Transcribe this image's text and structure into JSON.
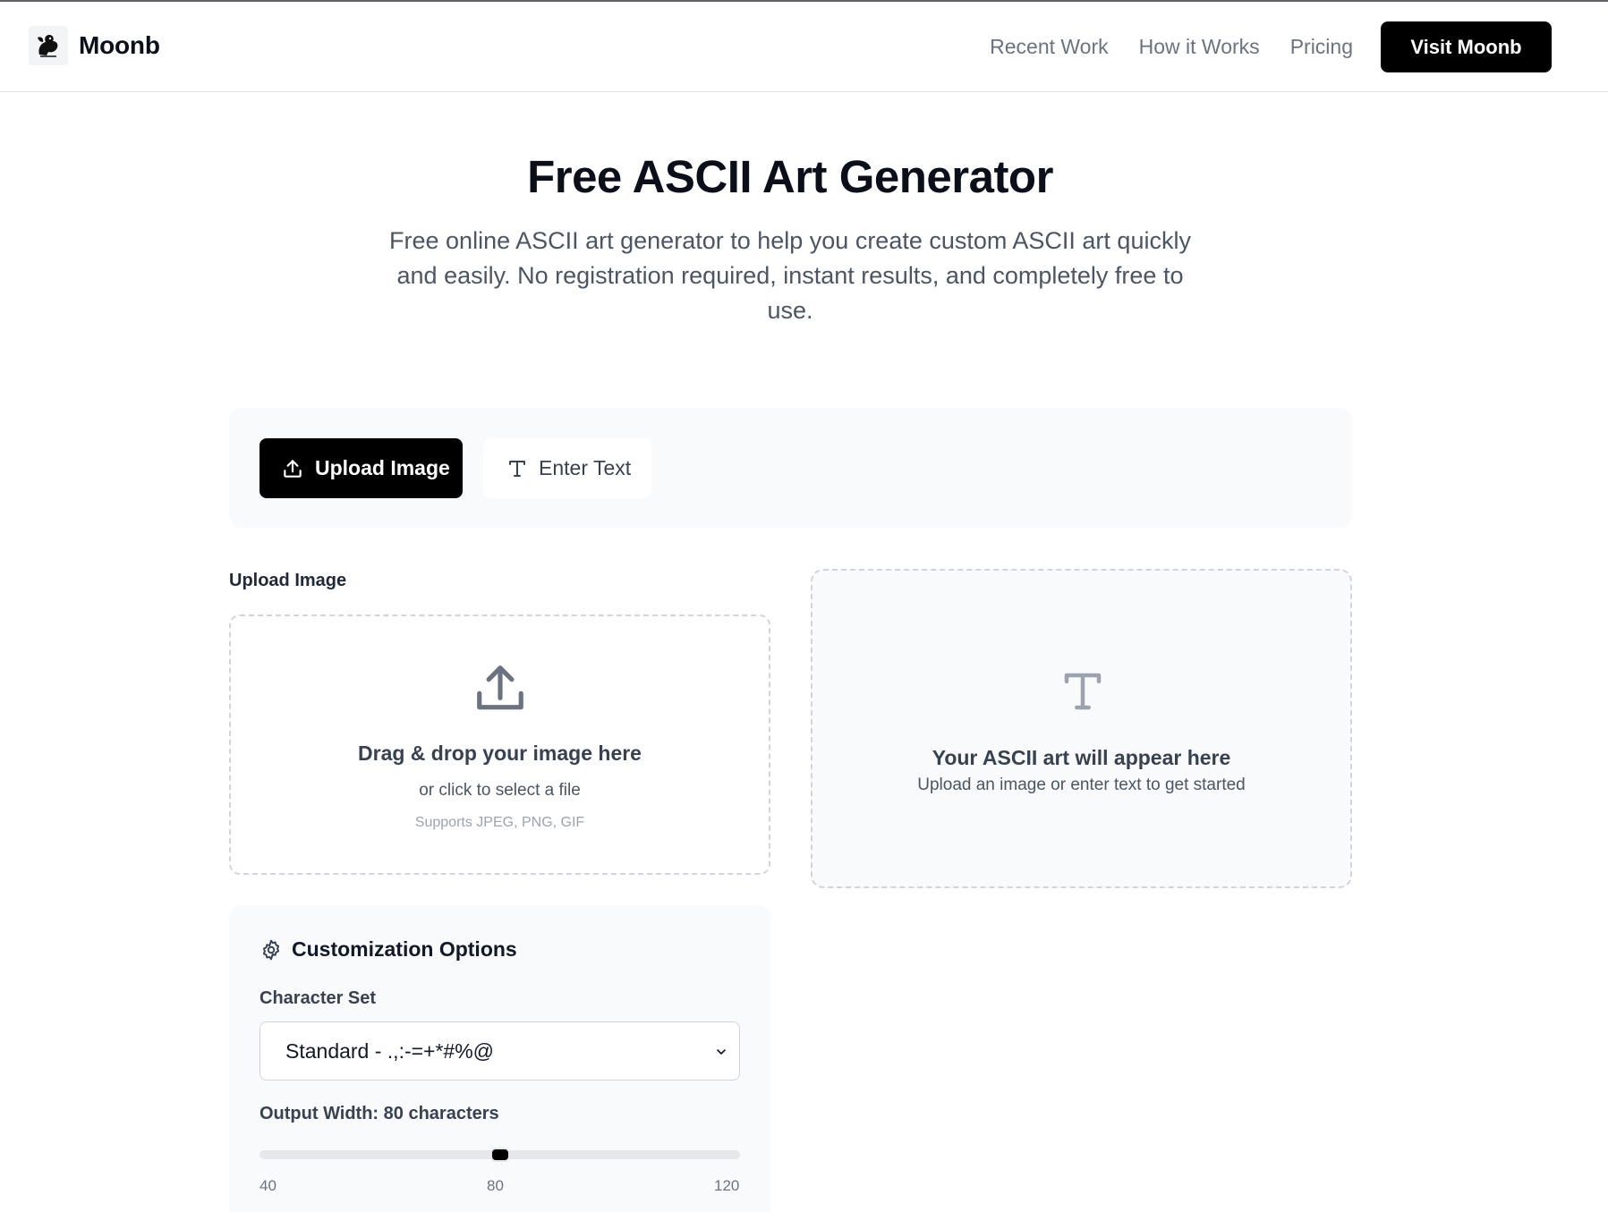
{
  "brand": {
    "name": "Moonb"
  },
  "nav": {
    "links": [
      "Recent Work",
      "How it Works",
      "Pricing"
    ],
    "cta": "Visit Moonb"
  },
  "hero": {
    "title": "Free ASCII Art Generator",
    "subtitle": "Free online ASCII art generator to help you create custom ASCII art quickly and easily. No registration required, instant results, and completely free to use."
  },
  "tabs": [
    {
      "label": "Upload Image",
      "icon": "upload-icon",
      "active": true
    },
    {
      "label": "Enter Text",
      "icon": "text-icon",
      "active": false
    }
  ],
  "upload": {
    "label": "Upload Image",
    "drop_title": "Drag & drop your image here",
    "drop_sub": "or click to select a file",
    "formats": "Supports JPEG, PNG, GIF"
  },
  "output": {
    "title": "Your ASCII art will appear here",
    "subtitle": "Upload an image or enter text to get started"
  },
  "customization": {
    "title": "Customization Options",
    "charset_label": "Character Set",
    "charset_value": "Standard - .,:-=+*#%@",
    "width_label": "Output Width: 80 characters",
    "slider": {
      "min": 40,
      "max": 120,
      "value": 80
    },
    "ticks": [
      "40",
      "80",
      "120"
    ]
  },
  "colors": {
    "primary": "#000000",
    "panel": "#f9fafb",
    "muted": "#6b7280",
    "border": "#d1d5db"
  }
}
